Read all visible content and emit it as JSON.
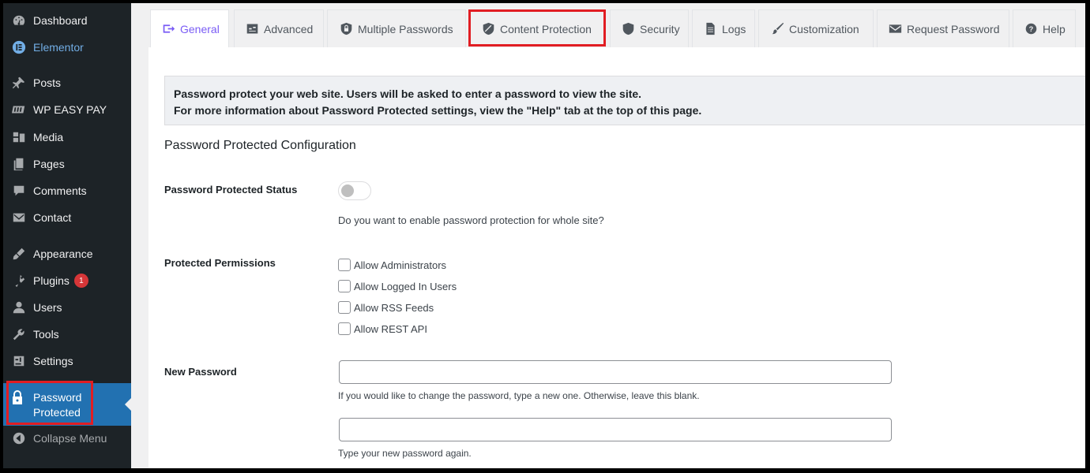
{
  "sidebar": {
    "items": [
      {
        "label": "Dashboard",
        "icon": "dashboard-icon"
      },
      {
        "label": "Elementor",
        "icon": "elementor-icon"
      },
      {
        "label": "Posts",
        "icon": "pin-icon"
      },
      {
        "label": "WP EASY PAY",
        "icon": "wp-easy-pay-icon"
      },
      {
        "label": "Media",
        "icon": "media-icon"
      },
      {
        "label": "Pages",
        "icon": "pages-icon"
      },
      {
        "label": "Comments",
        "icon": "comment-icon"
      },
      {
        "label": "Contact",
        "icon": "mail-icon"
      },
      {
        "label": "Appearance",
        "icon": "brush-icon"
      },
      {
        "label": "Plugins",
        "icon": "plugin-icon",
        "badge": "1"
      },
      {
        "label": "Users",
        "icon": "user-icon"
      },
      {
        "label": "Tools",
        "icon": "wrench-icon"
      },
      {
        "label": "Settings",
        "icon": "settings-icon"
      }
    ],
    "current": {
      "label_line1": "Password",
      "label_line2": "Protected",
      "icon": "lock-icon"
    },
    "collapse": {
      "label": "Collapse Menu",
      "icon": "collapse-icon"
    }
  },
  "tabs": [
    {
      "label": "General",
      "icon": "general-icon",
      "active": true
    },
    {
      "label": "Advanced",
      "icon": "advanced-icon"
    },
    {
      "label": "Multiple Passwords",
      "icon": "shield-lock-icon"
    },
    {
      "label": "Content Protection",
      "icon": "content-shield-icon",
      "highlighted": true
    },
    {
      "label": "Security",
      "icon": "shield-icon"
    },
    {
      "label": "Logs",
      "icon": "document-icon"
    },
    {
      "label": "Customization",
      "icon": "paintbrush-icon"
    },
    {
      "label": "Request Password",
      "icon": "envelope-icon"
    },
    {
      "label": "Help",
      "icon": "help-icon"
    }
  ],
  "notice": {
    "line1": "Password protect your web site. Users will be asked to enter a password to view the site.",
    "line2": "For more information about Password Protected settings, view the \"Help\" tab at the top of this page."
  },
  "config": {
    "heading": "Password Protected Configuration",
    "status_label": "Password Protected Status",
    "status_desc": "Do you want to enable password protection for whole site?",
    "status_enabled": false,
    "permissions_label": "Protected Permissions",
    "permissions": [
      {
        "label": "Allow Administrators",
        "checked": false
      },
      {
        "label": "Allow Logged In Users",
        "checked": false
      },
      {
        "label": "Allow RSS Feeds",
        "checked": false
      },
      {
        "label": "Allow REST API",
        "checked": false
      }
    ],
    "new_password_label": "New Password",
    "new_password_value": "",
    "new_password_hint": "If you would like to change the password, type a new one. Otherwise, leave this blank.",
    "confirm_password_value": "",
    "confirm_password_hint": "Type your new password again."
  },
  "colors": {
    "sidebar_bg": "#1d2327",
    "current_bg": "#2271b1",
    "active_tab_text": "#7a5cf5",
    "highlight_border": "#e11d23",
    "badge_bg": "#d63638"
  }
}
